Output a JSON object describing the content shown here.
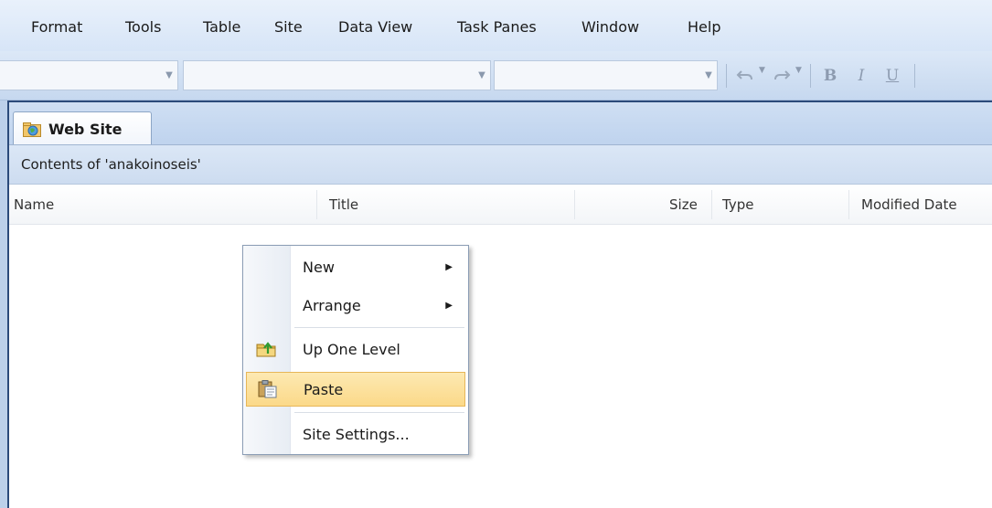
{
  "menubar": {
    "items": [
      "Format",
      "Tools",
      "Table",
      "Site",
      "Data View",
      "Task Panes",
      "Window",
      "Help"
    ]
  },
  "toolbar": {
    "bold": "B",
    "italic": "I",
    "underline": "U",
    "icons": [
      "undo-icon",
      "redo-icon",
      "bold-icon",
      "italic-icon",
      "underline-icon"
    ]
  },
  "tab": {
    "label": "Web Site",
    "icon": "website-icon"
  },
  "contents": {
    "label": "Contents of 'anakoinoseis'"
  },
  "columns": [
    "Name",
    "Title",
    "Size",
    "Type",
    "Modified Date"
  ],
  "context_menu": {
    "items": [
      {
        "label": "New",
        "submenu": true
      },
      {
        "label": "Arrange",
        "submenu": true
      },
      {
        "label": "Up One Level",
        "icon": "folder-up-icon"
      },
      {
        "label": "Paste",
        "icon": "paste-icon",
        "highlighted": true
      },
      {
        "label": "Site Settings..."
      }
    ]
  },
  "colors": {
    "menu_highlight": "#fbd989",
    "window_border": "#2b4a7a",
    "header_blue": "#cddcf0"
  }
}
